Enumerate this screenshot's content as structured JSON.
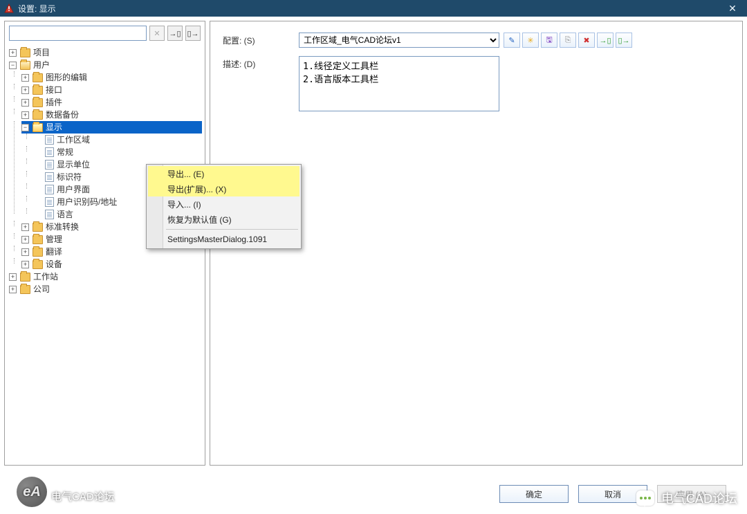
{
  "window": {
    "title": "设置: 显示"
  },
  "search": {
    "value": "",
    "placeholder": ""
  },
  "leftToolbar": {
    "clearTip": "✕",
    "importTip": "→▯",
    "exportTip": "▯→"
  },
  "tree": {
    "root": [
      {
        "label": "项目",
        "type": "folder",
        "state": "collapsed"
      },
      {
        "label": "用户",
        "type": "folder",
        "state": "expanded",
        "children": [
          {
            "label": "图形的编辑",
            "type": "folder",
            "state": "collapsed"
          },
          {
            "label": "接口",
            "type": "folder",
            "state": "collapsed"
          },
          {
            "label": "插件",
            "type": "folder",
            "state": "collapsed"
          },
          {
            "label": "数据备份",
            "type": "folder",
            "state": "collapsed"
          },
          {
            "label": "显示",
            "type": "folder",
            "state": "expanded",
            "selected": true,
            "children": [
              {
                "label": "工作区域",
                "type": "page"
              },
              {
                "label": "常规",
                "type": "page"
              },
              {
                "label": "显示单位",
                "type": "page"
              },
              {
                "label": "标识符",
                "type": "page"
              },
              {
                "label": "用户界面",
                "type": "page"
              },
              {
                "label": "用户识别码/地址",
                "type": "page"
              },
              {
                "label": "语言",
                "type": "page"
              }
            ]
          },
          {
            "label": "标准转换",
            "type": "folder",
            "state": "collapsed"
          },
          {
            "label": "管理",
            "type": "folder",
            "state": "collapsed"
          },
          {
            "label": "翻译",
            "type": "folder",
            "state": "collapsed"
          },
          {
            "label": "设备",
            "type": "folder",
            "state": "collapsed"
          }
        ]
      },
      {
        "label": "工作站",
        "type": "folder",
        "state": "collapsed"
      },
      {
        "label": "公司",
        "type": "folder",
        "state": "collapsed"
      }
    ]
  },
  "contextMenu": {
    "items": [
      {
        "label": "导出... (E)",
        "highlight": true
      },
      {
        "label": "导出(扩展)... (X)",
        "highlight": true
      },
      {
        "label": "导入... (I)"
      },
      {
        "label": "恢复为默认值 (G)"
      },
      {
        "sep": true
      },
      {
        "label": "SettingsMasterDialog.1091"
      }
    ]
  },
  "form": {
    "configLabel": "配置: (S)",
    "configValue": "工作区域_电气CAD论坛v1",
    "descLabel": "描述: (D)",
    "descValue": "1.线径定义工具栏\n2.语言版本工具栏"
  },
  "rightToolbar": {
    "b1": "✎",
    "b2": "✳",
    "b3": "🖫",
    "b4": "⎘",
    "b5": "✖",
    "b6": "→▯",
    "b7": "▯→"
  },
  "buttons": {
    "ok": "确定",
    "cancel": "取消",
    "apply": "应用 (A)"
  },
  "watermark": {
    "rightText": "电气CAD论坛",
    "leftBadge": "eA",
    "leftText": "电气CAD论坛"
  }
}
